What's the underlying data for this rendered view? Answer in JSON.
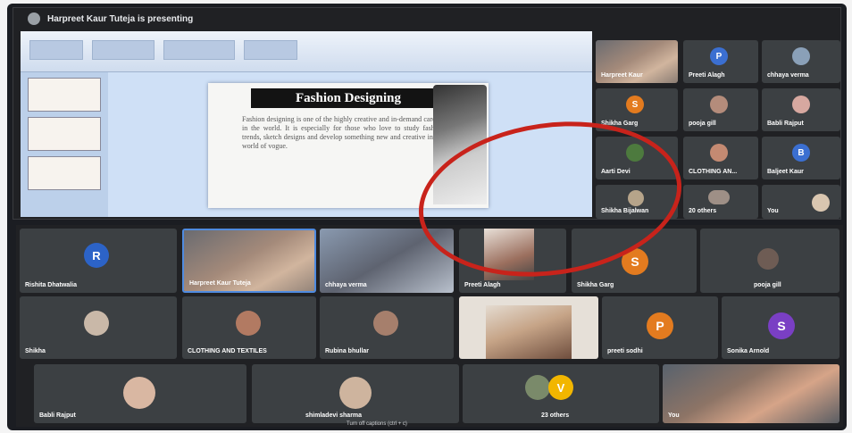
{
  "presenter_banner": "Harpreet Kaur Tuteja is presenting",
  "slide": {
    "title": "Fashion Designing",
    "body": "Fashion designing is one of the highly creative and in-demand careers in the world. It is especially for those who love to study fashion trends, sketch designs and develop something new and creative in the world of vogue."
  },
  "upper_tiles": [
    {
      "name": "Harpreet Kaur",
      "type": "video"
    },
    {
      "name": "Preeti Alagh",
      "letter": "P",
      "color": "#3b6fd1"
    },
    {
      "name": "chhaya verma",
      "type": "photo"
    },
    {
      "name": "Shikha Garg",
      "letter": "S",
      "color": "#e37b1f"
    },
    {
      "name": "pooja gill",
      "type": "photo"
    },
    {
      "name": "Babli Rajput",
      "type": "photo"
    },
    {
      "name": "Aarti Devi",
      "type": "photo"
    },
    {
      "name": "CLOTHING AN...",
      "type": "photo"
    },
    {
      "name": "Baljeet Kaur",
      "letter": "B",
      "color": "#3b6fd1"
    },
    {
      "name": "Shikha Bijalwan",
      "type": "photo"
    },
    {
      "name": "20 others",
      "type": "group"
    },
    {
      "name": "You",
      "type": "photo"
    }
  ],
  "lower_tiles": [
    {
      "name": "Rishita Dhatwalia",
      "letter": "R",
      "color": "#2c63c7"
    },
    {
      "name": "Harpreet Kaur Tuteja",
      "type": "video"
    },
    {
      "name": "chhaya verma",
      "type": "video"
    },
    {
      "name": "Preeti Alagh",
      "type": "video"
    },
    {
      "name": "Shikha Garg",
      "letter": "S",
      "color": "#e37b1f"
    },
    {
      "name": "pooja gill",
      "type": "photo"
    },
    {
      "name": "Shikha",
      "type": "photo"
    },
    {
      "name": "CLOTHING AND TEXTILES",
      "type": "photo"
    },
    {
      "name": "Rubina bhullar",
      "type": "photo"
    },
    {
      "name": "",
      "type": "video"
    },
    {
      "name": "preeti sodhi",
      "letter": "P",
      "color": "#e37b1f"
    },
    {
      "name": "Sonika Arnold",
      "letter": "S",
      "color": "#7a3fc4"
    },
    {
      "name": "Babli Rajput",
      "type": "photo"
    },
    {
      "name": "shimladevi sharma",
      "type": "photo"
    },
    {
      "name": "23 others",
      "letter": "V",
      "color": "#f2b600"
    },
    {
      "name": "You",
      "type": "video"
    }
  ],
  "footer": "Turn off captions (ctrl + c)"
}
